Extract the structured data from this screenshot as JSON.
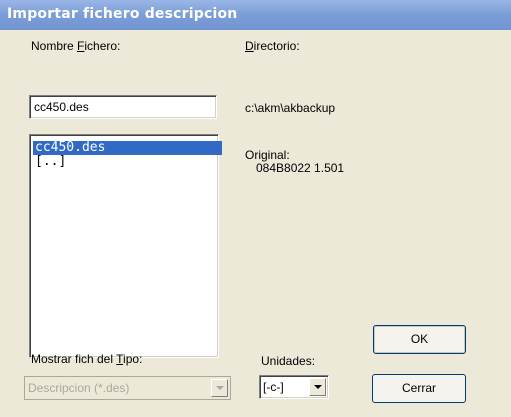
{
  "window": {
    "title": "Importar fichero descripcion"
  },
  "labels": {
    "nombre_fichero_pre": "Nombre ",
    "nombre_fichero_accel": "F",
    "nombre_fichero_post": "ichero:",
    "directorio_accel": "D",
    "directorio_post": "irectorio:",
    "mostrar_pre": "Mostrar fich del ",
    "mostrar_accel": "T",
    "mostrar_post": "ipo:",
    "unidades": "Unidades:",
    "original": "Original:"
  },
  "filename_input": {
    "value": "cc450.des"
  },
  "directory_path": "c:\\akm\\akbackup",
  "file_list": [
    {
      "label": "cc450.des",
      "selected": true
    },
    {
      "label": "[..]",
      "selected": false
    }
  ],
  "original_value": "084B8022 1.501",
  "file_type_select": {
    "value": "Descripcion (*.des)",
    "disabled": true
  },
  "drive_select": {
    "value": "[-c-]"
  },
  "buttons": {
    "ok": "OK",
    "cerrar": "Cerrar"
  },
  "colors": {
    "titlebar": "#7d9fd8",
    "selection": "#316ac5",
    "dialog_bg": "#ece9d8"
  }
}
